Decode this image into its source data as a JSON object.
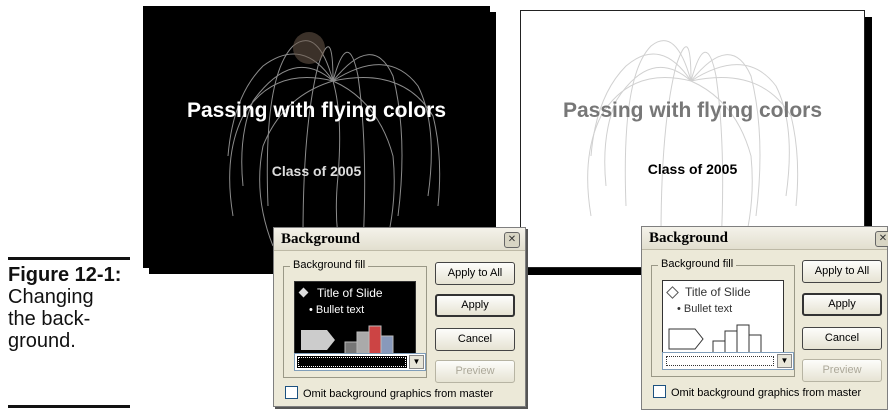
{
  "caption": {
    "figure": "Figure 12-1:",
    "lines": [
      "Changing",
      "the back-",
      "ground."
    ]
  },
  "slides": [
    {
      "title": "Passing with flying colors",
      "subtitle": "Class of 2005",
      "background": "#000000"
    },
    {
      "title": "Passing with flying colors",
      "subtitle": "Class of 2005",
      "background": "#ffffff"
    }
  ],
  "dialogs": [
    {
      "title": "Background",
      "group_label": "Background fill",
      "preview_title": "Title of Slide",
      "preview_bullet": "• Bullet text",
      "buttons": {
        "apply_all": "Apply to All",
        "apply": "Apply",
        "cancel": "Cancel",
        "preview": "Preview"
      },
      "omit_label": "Omit background graphics from master",
      "fill_color": "#000000"
    },
    {
      "title": "Background",
      "group_label": "Background fill",
      "preview_title": "Title of Slide",
      "preview_bullet": "• Bullet text",
      "buttons": {
        "apply_all": "Apply to All",
        "apply": "Apply",
        "cancel": "Cancel",
        "preview": "Preview"
      },
      "omit_label": "Omit background graphics from master",
      "fill_color": "#ffffff"
    }
  ]
}
